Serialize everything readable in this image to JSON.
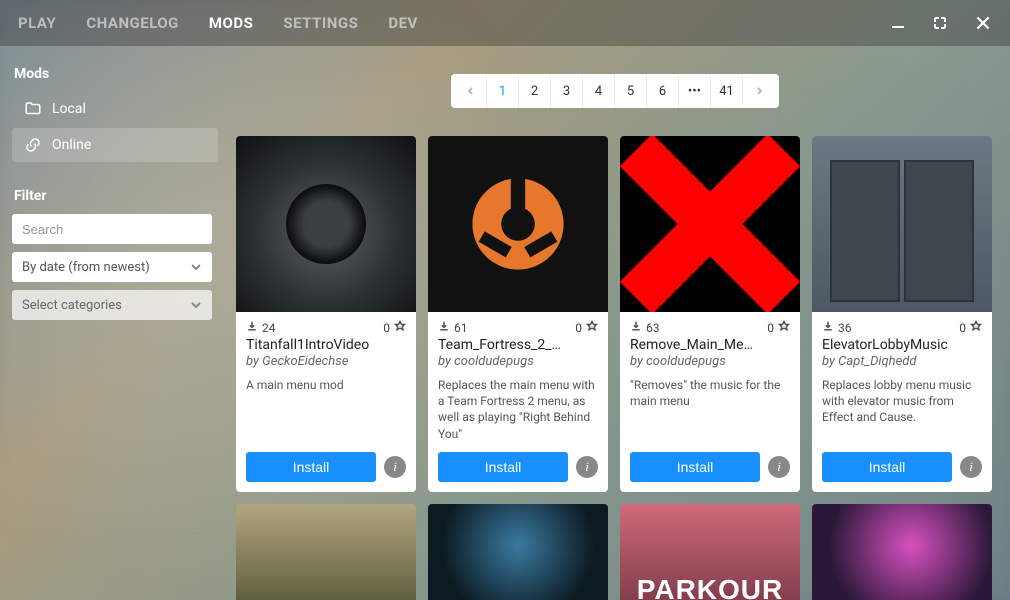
{
  "nav": {
    "tabs": [
      "PLAY",
      "CHANGELOG",
      "MODS",
      "SETTINGS",
      "DEV"
    ],
    "active": "MODS"
  },
  "sidebar": {
    "heading": "Mods",
    "items": [
      {
        "label": "Local",
        "icon": "folder"
      },
      {
        "label": "Online",
        "icon": "link"
      }
    ],
    "active": "Online",
    "filter_heading": "Filter",
    "search_placeholder": "Search",
    "sort_value": "By date (from newest)",
    "category_placeholder": "Select categories"
  },
  "pagination": {
    "pages": [
      "1",
      "2",
      "3",
      "4",
      "5",
      "6",
      "•••",
      "41"
    ],
    "active": "1"
  },
  "install_label": "Install",
  "cards": [
    {
      "downloads": "24",
      "stars": "0",
      "title": "Titanfall1IntroVideo",
      "author": "by GeckoEidechse",
      "desc": "A main menu mod"
    },
    {
      "downloads": "61",
      "stars": "0",
      "title": "Team_Fortress_2_…",
      "author": "by cooldudepugs",
      "desc": "Replaces the main menu with a Team Fortress 2 menu, as well as playing \"Right Behind You\""
    },
    {
      "downloads": "63",
      "stars": "0",
      "title": "Remove_Main_Me…",
      "author": "by cooldudepugs",
      "desc": "\"Removes\" the music for the main menu"
    },
    {
      "downloads": "36",
      "stars": "0",
      "title": "ElevatorLobbyMusic",
      "author": "by Capt_Diqhedd",
      "desc": "Replaces lobby menu music with elevator music from Effect and Cause."
    }
  ],
  "peek_parkour": "PARKOUR"
}
